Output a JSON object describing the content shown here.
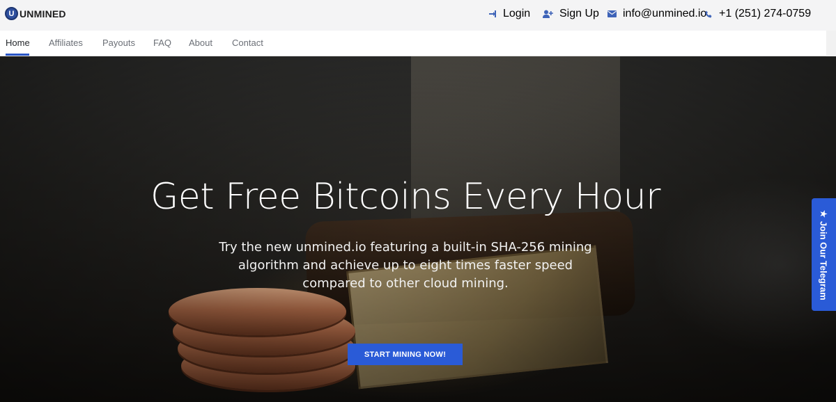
{
  "brand": {
    "mark": "U",
    "name": "UNMINED"
  },
  "top_links": {
    "login": "Login",
    "signup": "Sign Up",
    "email": "info@unmined.io",
    "phone": "+1 (251) 274-0759"
  },
  "nav": {
    "items": [
      {
        "label": "Home",
        "active": true
      },
      {
        "label": "Affiliates"
      },
      {
        "label": "Payouts"
      },
      {
        "label": "FAQ"
      },
      {
        "label": "About"
      },
      {
        "label": "Contact"
      }
    ]
  },
  "hero": {
    "title": "Get Free Bitcoins Every Hour",
    "subtitle": "Try the new unmined.io featuring a built-in SHA-256 mining algorithm and achieve up to eight times faster speed compared to other cloud mining.",
    "cta": "START MINING NOW!"
  },
  "side_tab": {
    "label": "Join Our Telegram",
    "icon": "star-icon"
  },
  "colors": {
    "accent": "#2a5bd7",
    "topbar": "#f4f4f5"
  }
}
